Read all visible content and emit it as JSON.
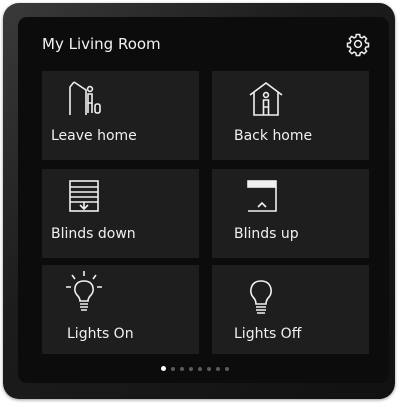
{
  "header": {
    "title": "My Living Room"
  },
  "tiles": [
    {
      "label": "Leave home",
      "icon": "leave-home-icon"
    },
    {
      "label": "Back home",
      "icon": "back-home-icon"
    },
    {
      "label": "Blinds down",
      "icon": "blinds-down-icon"
    },
    {
      "label": "Blinds up",
      "icon": "blinds-up-icon"
    },
    {
      "label": "Lights On",
      "icon": "light-bulb-on-icon"
    },
    {
      "label": "Lights Off",
      "icon": "light-bulb-off-icon"
    }
  ],
  "pagination": {
    "pages": 8,
    "active_page": 1
  },
  "colors": {
    "background": "#0c0c0c",
    "tile": "#1e1e1e",
    "text": "#f0f0f0",
    "dot_inactive": "#5a5a5a",
    "dot_active": "#ffffff"
  }
}
